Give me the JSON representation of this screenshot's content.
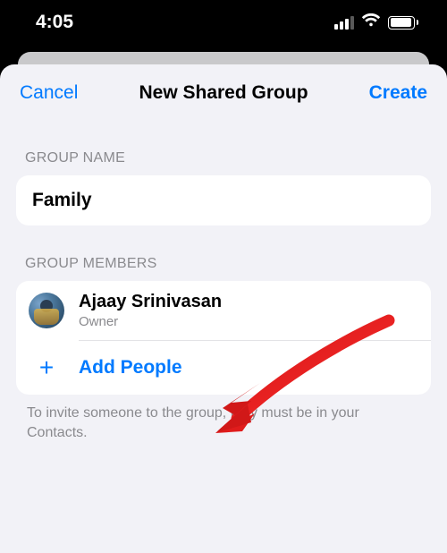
{
  "status_bar": {
    "time": "4:05"
  },
  "nav": {
    "cancel": "Cancel",
    "title": "New Shared Group",
    "create": "Create"
  },
  "group_name": {
    "header": "GROUP NAME",
    "value": "Family"
  },
  "group_members": {
    "header": "GROUP MEMBERS",
    "owner": {
      "name": "Ajaay Srinivasan",
      "role": "Owner"
    },
    "add_label": "Add People"
  },
  "footer_hint": "To invite someone to the group, they must be in your Contacts."
}
